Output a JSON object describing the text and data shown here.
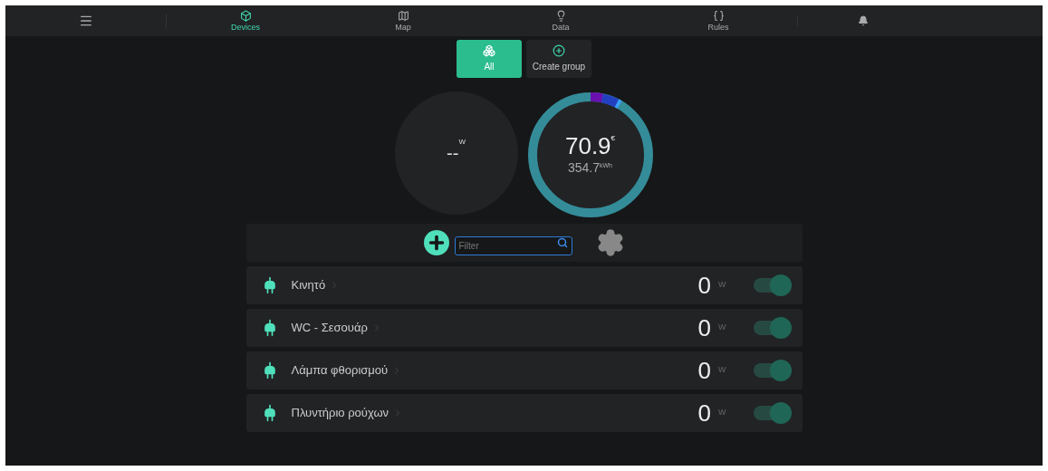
{
  "nav": {
    "tabs": [
      {
        "kind": "devices",
        "label": "Devices",
        "selected": true
      },
      {
        "kind": "map",
        "label": "Map",
        "selected": false
      },
      {
        "kind": "data",
        "label": "Data",
        "selected": false
      },
      {
        "kind": "rules",
        "label": "Rules",
        "selected": false
      }
    ]
  },
  "groups": [
    {
      "kind": "all",
      "label": "All",
      "selected": true
    },
    {
      "kind": "create",
      "label": "Create group",
      "selected": false
    }
  ],
  "power": {
    "value": "--",
    "unit": "W"
  },
  "cost": {
    "value": "70.9",
    "unit": "€",
    "energy": "354.7",
    "energy_unit": "kWh"
  },
  "filter": {
    "placeholder": "Filter"
  },
  "devices": [
    {
      "name": "Κινητό",
      "power": "0",
      "unit": "W",
      "on": true
    },
    {
      "name": "WC - Σεσουάρ",
      "power": "0",
      "unit": "W",
      "on": true
    },
    {
      "name": "Λάμπα φθορισμού",
      "power": "0",
      "unit": "W",
      "on": true
    },
    {
      "name": "Πλυντήριο ρούχων",
      "power": "0",
      "unit": "W",
      "on": true
    }
  ]
}
